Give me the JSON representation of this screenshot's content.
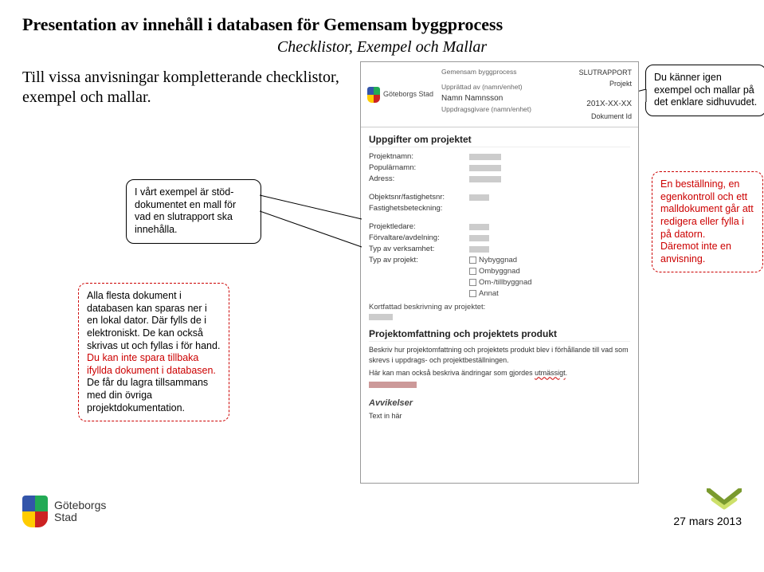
{
  "title": "Presentation av innehåll i databasen för Gemensam byggprocess",
  "subtitle": "Checklistor, Exempel och Mallar",
  "intro": "Till vissa anvisningar kompletterande checklistor, exempel och mallar.",
  "callouts": {
    "top_right": "Du känner igen exempel och mallar på det enklare sidhuvudet.",
    "stod": "I vårt exempel är stöd-dokumentet en mall för vad en slutrapport ska innehålla.",
    "alla_flesta": "Alla flesta dokument i databasen kan sparas ner i en lokal dator. Där fylls de i elektroniskt. De kan också skrivas ut och fyllas i för hand.",
    "alla_flesta_red1": "Du kan inte spara tillbaka ifyllda dokument i databasen.",
    "alla_flesta_red2": "De får du lagra tillsammans med din övriga projektdokumentation.",
    "bestallning": "En beställning, en egenkontroll och ett malldokument går att redigera eller fylla i på datorn.",
    "bestallning_red": "Däremot inte en anvisning."
  },
  "doc": {
    "logo_text": "Göteborgs Stad",
    "meta1": "Gemensam byggprocess",
    "meta_upp": "Upprättad av (namn/enhet)",
    "meta_namn": "Namn Namnsson",
    "meta_uppd": "Uppdragsgivare (namn/enhet)",
    "top_slut": "SLUTRAPPORT",
    "top_proj": "Projekt",
    "top_date": "201X-XX-XX",
    "top_docid": "Dokument Id",
    "h_uppg": "Uppgifter om projektet",
    "rows": {
      "projektnamn": "Projektnamn:",
      "popularnamn": "Populärnamn:",
      "adress": "Adress:",
      "objektsnr": "Objektsnr/fastighetsnr:",
      "fastbet": "Fastighetsbeteckning:",
      "projled": "Projektledare:",
      "forvalt": "Förvaltare/avdelning:",
      "typverk": "Typ av verksamhet:",
      "typproj": "Typ av projekt:",
      "kortf": "Kortfattad beskrivning av projektet:"
    },
    "checks": {
      "ny": "Nybyggnad",
      "om": "Ombyggnad",
      "omtill": "Om-/tillbyggnad",
      "annat": "Annat"
    },
    "h_omf": "Projektomfattning och projektets produkt",
    "omf_text1": "Beskriv hur projektomfattning och projektets produkt blev i förhållande till vad som skrevs i uppdrags- och projektbeställningen.",
    "omf_text2_a": "Här kan man också beskriva ändringar som gjordes ",
    "omf_text2_b": "utmässigt",
    "omf_text2_c": ".",
    "avv_h": "Avvikelser",
    "avv_t": "Text in här"
  },
  "footer": {
    "logo_l1": "Göteborgs",
    "logo_l2": "Stad",
    "date": "27 mars 2013"
  }
}
